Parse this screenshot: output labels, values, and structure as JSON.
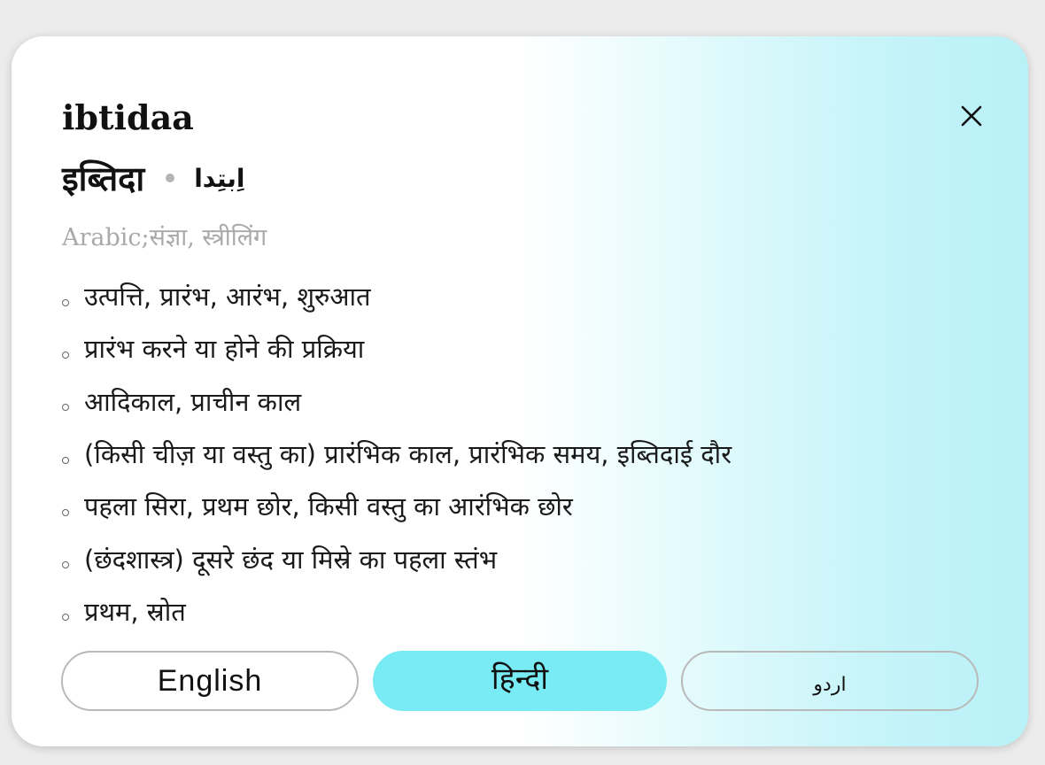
{
  "entry": {
    "title": "ibtidaa",
    "hindi": "इब्तिदा",
    "urdu": "اِبتِدا",
    "meta": "Arabic;संज्ञा, स्त्रीलिंग"
  },
  "meanings": [
    "उत्पत्ति, प्रारंभ, आरंभ, शुरुआत",
    "प्रारंभ करने या होने की प्रक्रिया",
    "आदिकाल, प्राचीन काल",
    "(किसी चीज़ या वस्तु का) प्रारंभिक काल, प्रारंभिक समय, इब्तिदाई दौर",
    "पहला सिरा, प्रथम छोर, किसी वस्तु का आरंभिक छोर",
    "(छंदशास्त्र) दूसरे छंद या मिस्रे का पहला स्तंभ",
    "प्रथम, स्रोत"
  ],
  "languages": {
    "english": "English",
    "hindi": "हिन्दी",
    "urdu": "اردو",
    "selected": "hindi"
  },
  "icons": {
    "close": "close-icon",
    "separator": "dot-separator",
    "bullet": "circle-bullet"
  },
  "colors": {
    "selected_tab": "#79ebf4",
    "gradient_end": "#b8f1f7",
    "meta_text": "#a9a9a9"
  }
}
